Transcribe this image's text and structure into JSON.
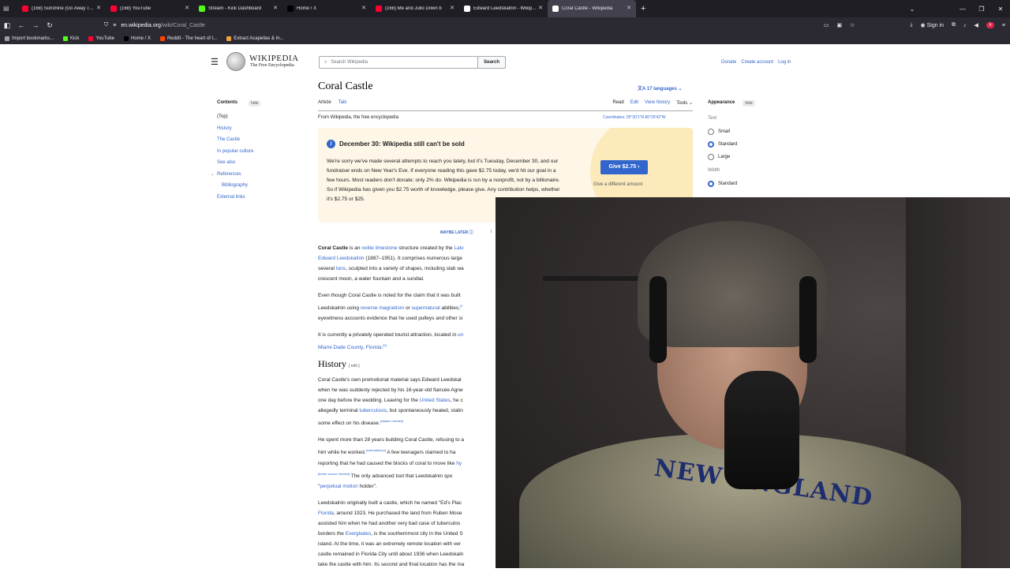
{
  "browser": {
    "tabs": [
      {
        "label": "(168) Sunshine (Go Away Today)",
        "color": "#ff0033",
        "active": false
      },
      {
        "label": "(168) YouTube",
        "color": "#ff0033",
        "active": false
      },
      {
        "label": "Stream - Kick Dashboard",
        "color": "#53fc18",
        "active": false
      },
      {
        "label": "Home / X",
        "color": "#000000",
        "active": false
      },
      {
        "label": "(168) Me and Julio Down b",
        "color": "#ff0033",
        "active": false
      },
      {
        "label": "Edward Leedskalnin - Wikipedia",
        "color": "#ffffff",
        "active": false
      },
      {
        "label": "Coral Castle - Wikipedia",
        "color": "#ffffff",
        "active": true
      }
    ],
    "url_domain": "en.wikipedia.org",
    "url_path": "/wiki/Coral_Castle",
    "sign_in": "Sign in",
    "bookmarks": [
      {
        "label": "Import bookmarks...",
        "color": "#9aa0a6"
      },
      {
        "label": "Kick",
        "color": "#53fc18"
      },
      {
        "label": "YouTube",
        "color": "#ff0033"
      },
      {
        "label": "Home / X",
        "color": "#000000"
      },
      {
        "label": "Reddit - The heart of t...",
        "color": "#ff4500"
      },
      {
        "label": "Extract Acapellas & In...",
        "color": "#f2a33a"
      }
    ]
  },
  "wiki": {
    "logo_title": "WIKIPEDIA",
    "logo_sub": "The Free Encyclopedia",
    "search_placeholder": "Search Wikipedia",
    "search_button": "Search",
    "donate": "Donate",
    "create_account": "Create account",
    "login": "Log in",
    "toc_title": "Contents",
    "hide": "hide",
    "toc": [
      "(Top)",
      "History",
      "The Castle",
      "In popular culture",
      "See also",
      "References",
      "Bibliography",
      "External links"
    ],
    "page_title": "Coral Castle",
    "languages": "17 languages",
    "tab_article": "Article",
    "tab_talk": "Talk",
    "tab_read": "Read",
    "tab_edit": "Edit",
    "tab_history": "View history",
    "tab_tools": "Tools",
    "from": "From Wikipedia, the free encyclopedia",
    "coordinates": "Coordinates: 25°30′1″N 80°26′42″W",
    "banner_heading": "December 30: Wikipedia still can't be sold",
    "banner_text": "We're sorry we've made several attempts to reach you lately, but it's Tuesday, December 30, and our fundraiser ends on New Year's Eve. If everyone reading this gave $2.75 today, we'd hit our goal in a few hours. Most readers don't donate; only 2% do. Wikipedia is run by a nonprofit, not by a billionaire. So if Wikipedia has given you $2.75 worth of knowledge, please give. Any contribution helps, whether it's $2.75 or $25.",
    "give_button": "Give $2.75",
    "give_alt": "Give a different amount",
    "maybe_later": "MAYBE LATER",
    "appearance": "Appearance",
    "text_label": "Text",
    "text_options": [
      "Small",
      "Standard",
      "Large"
    ],
    "width_label": "Width",
    "width_options": [
      "Standard"
    ],
    "history_heading": "History",
    "edit_label": "edit"
  },
  "webcam": {
    "shirt_text": "NEW ENGLAND"
  }
}
